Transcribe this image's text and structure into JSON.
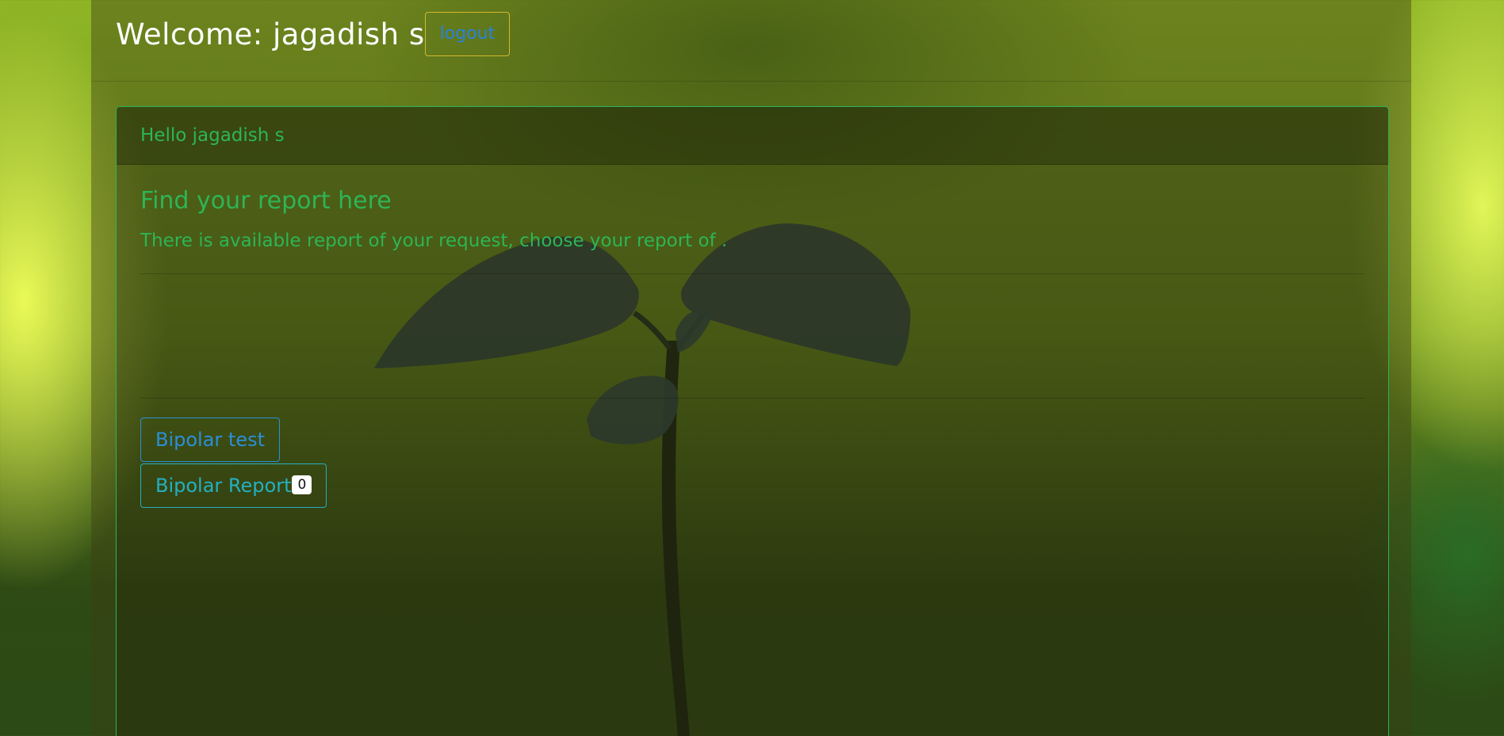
{
  "header": {
    "welcome_text": "Welcome: jagadish s",
    "logout_label": "logout"
  },
  "card": {
    "header_text": "Hello jagadish s",
    "title": "Find your report here",
    "text": "There is available report of your request, choose your report of ."
  },
  "actions": {
    "test_button_label": "Bipolar test",
    "report_button_label": "Bipolar Report",
    "report_count": "0"
  },
  "colors": {
    "accent_green": "#2db556",
    "link_blue": "#2a8fd8",
    "info_cyan": "#23b0c2",
    "logout_border": "#d4b82a"
  }
}
